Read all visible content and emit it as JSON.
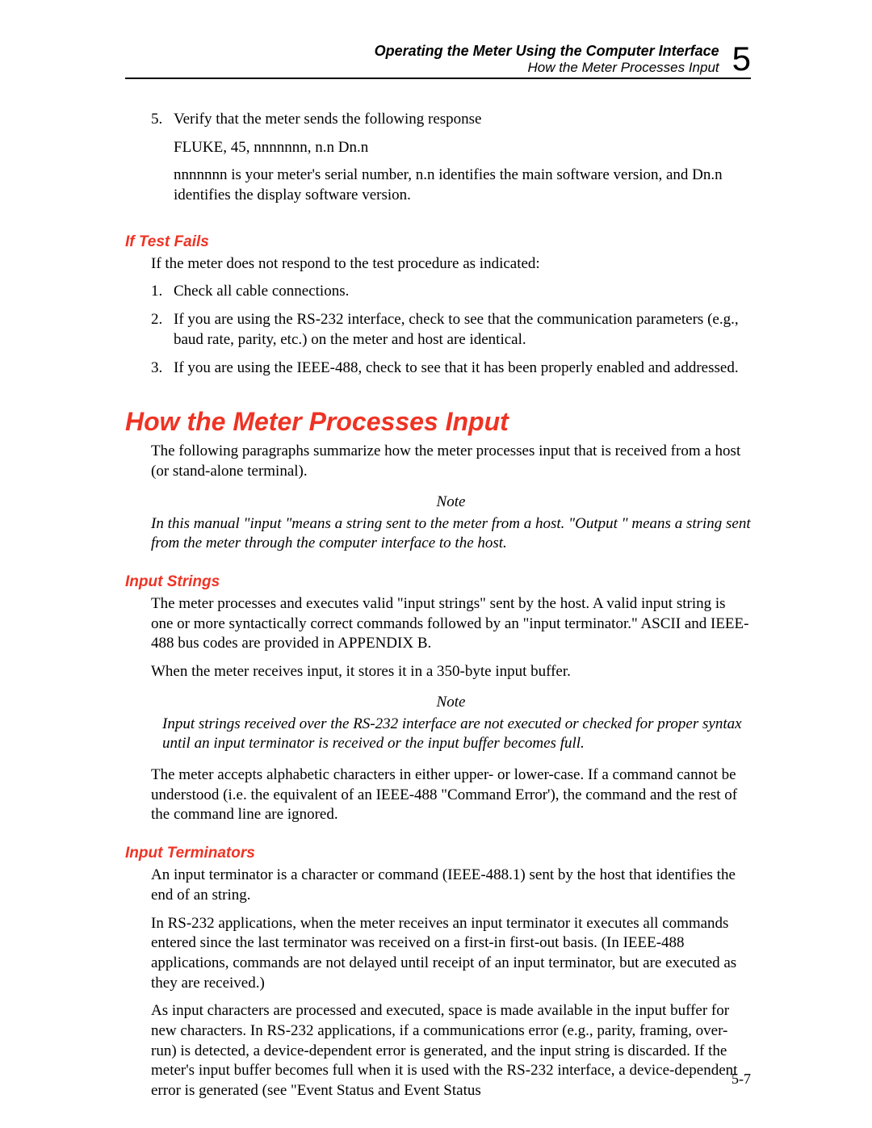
{
  "header": {
    "line1": "Operating the Meter Using the Computer Interface",
    "line2": "How the Meter Processes Input",
    "chapter": "5"
  },
  "step5": {
    "num": "5.",
    "p1": "Verify that the meter sends the following response",
    "p2": "FLUKE, 45, nnnnnnn, n.n Dn.n",
    "p3": "nnnnnnn is your meter's serial number, n.n identifies the main software version, and Dn.n identifies the display software version."
  },
  "ifTestFails": {
    "heading": "If Test Fails",
    "intro": "If the meter does not respond to the test procedure as indicated:",
    "items": [
      {
        "num": "1.",
        "text": "Check all cable connections."
      },
      {
        "num": "2.",
        "text": "If you are using the RS-232 interface, check to see that the communication parameters (e.g., baud rate, parity, etc.) on the meter and host are identical."
      },
      {
        "num": "3.",
        "text": "If you are using the IEEE-488, check to see that it has been properly enabled and addressed."
      }
    ]
  },
  "mainHeading": "How the Meter Processes Input",
  "mainIntro": "The following paragraphs summarize how the meter processes input that is received from a host (or stand-alone terminal).",
  "note1": {
    "label": "Note",
    "body": "In this manual \"input \"means a string sent to the meter from a host. \"Output \" means a string sent from the meter through the computer interface to the host."
  },
  "inputStrings": {
    "heading": "Input Strings",
    "p1": "The meter processes and executes valid \"input strings\" sent by the host. A valid input string is one or more syntactically correct commands followed by an \"input terminator.\" ASCII and IEEE-488 bus codes are provided in APPENDIX B.",
    "p2": "When the meter receives input, it stores it in a 350-byte input buffer.",
    "noteLabel": "Note",
    "noteBody": "Input strings received over the RS-232 interface are not executed or checked for proper syntax until an input terminator is received or the input buffer becomes full.",
    "p3": "The meter accepts alphabetic characters in either upper- or lower-case. If a command cannot be understood (i.e. the equivalent of an IEEE-488 \"Command Error'), the command and the rest of the command line are ignored."
  },
  "inputTerminators": {
    "heading": "Input Terminators",
    "p1": "An input terminator is a character or command (IEEE-488.1) sent by the host that identifies the end of an string.",
    "p2": "In RS-232 applications, when the meter receives an input terminator it executes all commands entered since the last terminator was received on a first-in first-out basis. (In IEEE-488 applications, commands are not delayed until receipt of an input terminator, but are executed as they are received.)",
    "p3": "As input characters are processed and executed, space is made available in the input buffer for new characters. In RS-232 applications, if a communications error (e.g., parity, framing, over-run) is detected, a device-dependent error is generated, and the input string is discarded. If the meter's input buffer becomes full when it is used with the RS-232 interface, a device-dependent error is generated (see \"Event Status and Event Status"
  },
  "pageNum": "5-7"
}
